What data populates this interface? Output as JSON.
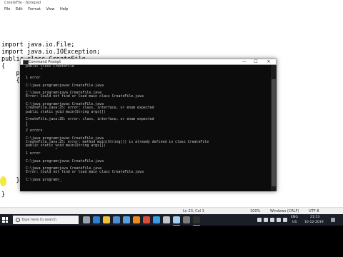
{
  "notepad": {
    "window_title": "CreateFile - Notepad",
    "menu": [
      "File",
      "Edit",
      "Format",
      "View",
      "Help"
    ],
    "code": [
      "import java.io.File;",
      "import java.io.IOException;",
      "public class CreateFile",
      "{",
      "    pu",
      "    {",
      "",
      "",
      "",
      "",
      "",
      "",
      "",
      "",
      "",
      "",
      "        }",
      "",
      "    }",
      "",
      "}"
    ],
    "status": {
      "position": "Ln 23, Col 1",
      "zoom": "100%",
      "line_ending": "Windows (CRLF)",
      "encoding": "UTF-8"
    }
  },
  "cmd": {
    "title": "Command Prompt",
    "lines": [
      "public class CreateFile",
      "       ^",
      "",
      "1 error",
      "",
      "C:\\java program>javac CreateFile.java",
      "",
      "C:\\java program>java CreateFile.java",
      "Error: Could not find or load main class CreateFile.java",
      "",
      "C:\\java program>javac CreateFile.java",
      "CreateFile.java:25: error: class, interface, or enum expected",
      "public static void main(String args[])",
      "              ^",
      "CreateFile.java:28: error: class, interface, or enum expected",
      "}",
      "^",
      "2 errors",
      "",
      "C:\\java program>javac CreateFile.java",
      "CreateFile.java:25: error: method main(String[]) is already defined in class CreateFile",
      "public static void main(String args[])",
      "              ^",
      "1 error",
      "",
      "C:\\java program>javac CreateFile.java",
      "",
      "C:\\java program>java CreateFile.java",
      "Error: Could not find or load main class CreateFile.java",
      "",
      "C:\\java program>_"
    ],
    "controls": [
      "—",
      "☐",
      "✕"
    ]
  },
  "taskbar": {
    "search_placeholder": "Type here to search",
    "time": "21:53",
    "date": "16-12-2019",
    "language": "ENG",
    "region": "US",
    "apps": [
      {
        "name": "task-view",
        "color": "#9aa3ad"
      },
      {
        "name": "edge",
        "color": "#2d7fd3"
      },
      {
        "name": "file-explorer",
        "color": "#f0c13a"
      },
      {
        "name": "store",
        "color": "#4a8fd6"
      },
      {
        "name": "mail",
        "color": "#5aa0e0"
      },
      {
        "name": "vlc",
        "color": "#f08a1c"
      },
      {
        "name": "chrome",
        "color": "#e04a3a"
      },
      {
        "name": "photos",
        "color": "#3a9be0"
      },
      {
        "name": "settings",
        "color": "#c0c6cc"
      },
      {
        "name": "notepad",
        "color": "#a6cdf2"
      },
      {
        "name": "app",
        "color": "#7a7a7a"
      },
      {
        "name": "cmd",
        "color": "#303030"
      }
    ]
  }
}
